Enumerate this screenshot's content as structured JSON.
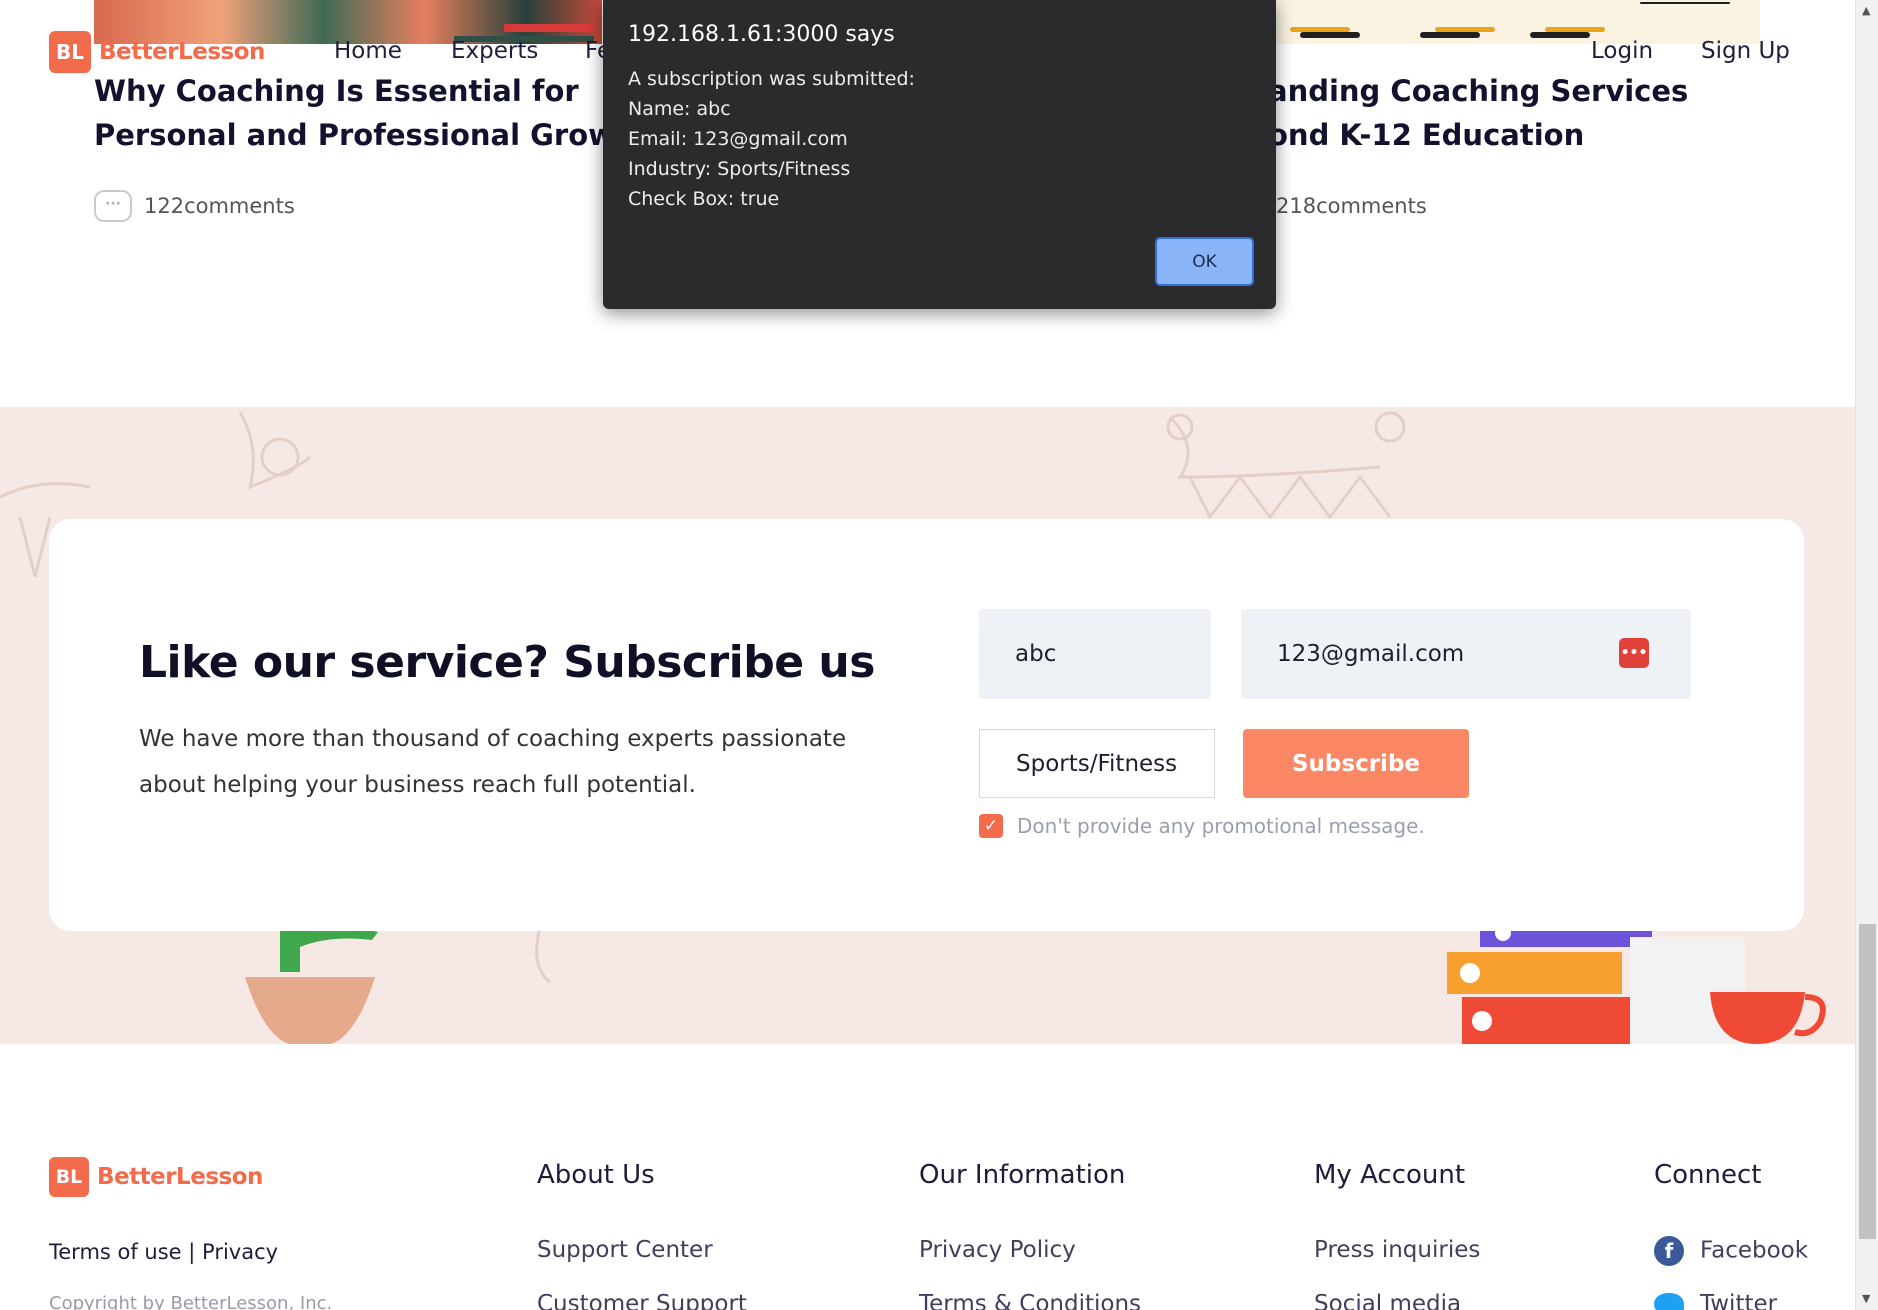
{
  "brand": {
    "logo_mark": "BL",
    "name": "BetterLesson",
    "color": "#f26b4b"
  },
  "nav": {
    "home": "Home",
    "experts": "Experts",
    "partial": "Fe",
    "login": "Login",
    "signup": "Sign Up"
  },
  "articles": [
    {
      "title_line1": "Why Coaching Is Essential for",
      "title_line2": "Personal and Professional Growth",
      "comments": "122comments"
    },
    {
      "title_line1": "anding Coaching Services",
      "title_line2": "ond K-12 Education",
      "comments": "218comments"
    }
  ],
  "dialog": {
    "title": "192.168.1.61:3000 says",
    "lines": [
      "A subscription was submitted:",
      "Name: abc",
      "Email: 123@gmail.com",
      "Industry: Sports/Fitness",
      "Check Box: true"
    ],
    "ok_label": "OK"
  },
  "subscribe": {
    "heading": "Like our service? Subscribe us",
    "text_line1": "We have more than thousand of coaching experts passionate",
    "text_line2": "about helping your business reach full potential.",
    "name_value": "abc",
    "email_value": "123@gmail.com",
    "industry_value": "Sports/Fitness",
    "button_label": "Subscribe",
    "checkbox_checked": true,
    "checkbox_label": "Don't provide any promotional message."
  },
  "footer": {
    "legal": "Terms of use | Privacy",
    "copyright": "Copyright by BetterLesson, Inc.",
    "columns": [
      {
        "heading": "About Us",
        "links": [
          "Support Center",
          "Customer Support"
        ]
      },
      {
        "heading": "Our Information",
        "links": [
          "Privacy Policy",
          "Terms & Conditions"
        ]
      },
      {
        "heading": "My Account",
        "links": [
          "Press inquiries",
          "Social media"
        ]
      },
      {
        "heading": "Connect",
        "links": [
          "Facebook",
          "Twitter"
        ]
      }
    ]
  },
  "icons": {
    "comment": "comment-bubble-icon",
    "password_manager": "password-manager-icon",
    "checkbox": "checkmark-icon",
    "facebook": "facebook-icon",
    "twitter": "twitter-icon"
  },
  "colors": {
    "accent": "#f26b4b",
    "subscribe_button": "#fc8764",
    "section_bg": "#f6e9e5",
    "dialog_bg": "#2b2b2e",
    "dialog_button": "#8ab4f8"
  }
}
